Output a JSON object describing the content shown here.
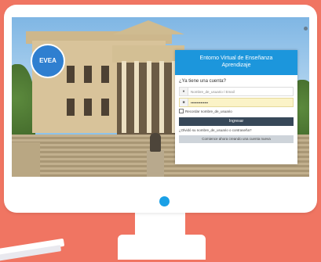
{
  "logo": {
    "text": "EVEA"
  },
  "login": {
    "title_line1": "Entorno Virtual de Enseñanza",
    "title_line2": "Aprendizaje",
    "question": "¿Ya tiene una cuenta?",
    "username_placeholder": "Nombre_de_usuario / Email",
    "password_value": "••••••••••••••",
    "remember_label": "Recordar nombre_de_usuario",
    "submit_label": "Ingresar",
    "forgot_link": "¿Olvidó su nombre_de_usuario o contraseña?",
    "create_account_label": "Comience ahora creando una cuenta nueva"
  },
  "icons": {
    "user": "user-icon",
    "lock": "lock-icon",
    "power": "power-indicator"
  },
  "colors": {
    "background": "#f07562",
    "header_blue": "#1c96dc",
    "login_button": "#374859",
    "create_button": "#ced4da",
    "password_field": "#fbf3c7",
    "power_dot": "#1aa0e6"
  }
}
